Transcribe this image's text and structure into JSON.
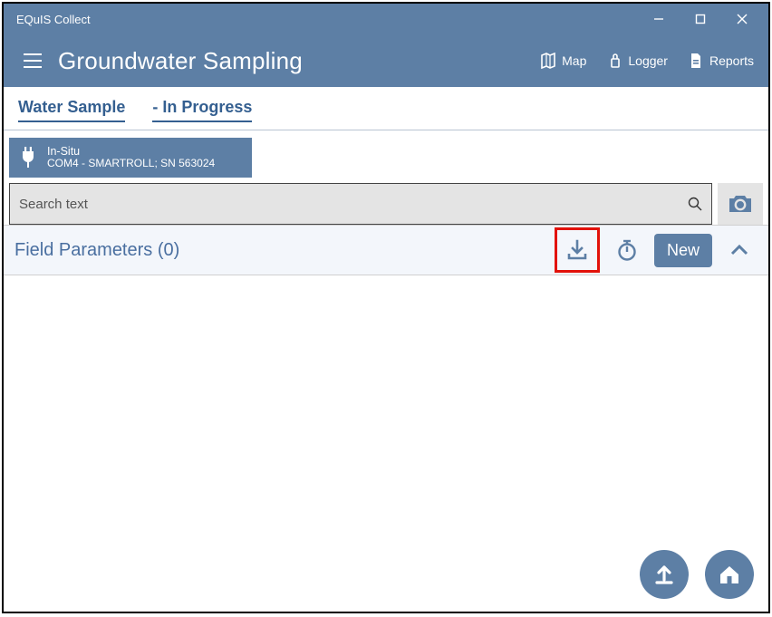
{
  "window": {
    "title": "EQuIS Collect"
  },
  "appbar": {
    "title": "Groundwater Sampling",
    "nav": {
      "map": "Map",
      "logger": "Logger",
      "reports": "Reports"
    }
  },
  "tabs": {
    "sample": "Water Sample",
    "status": "- In Progress"
  },
  "device": {
    "vendor": "In-Situ",
    "port": "COM4 - SMARTROLL; SN 563024"
  },
  "search": {
    "placeholder": "Search text"
  },
  "section": {
    "title": "Field Parameters (0)",
    "new_label": "New"
  }
}
